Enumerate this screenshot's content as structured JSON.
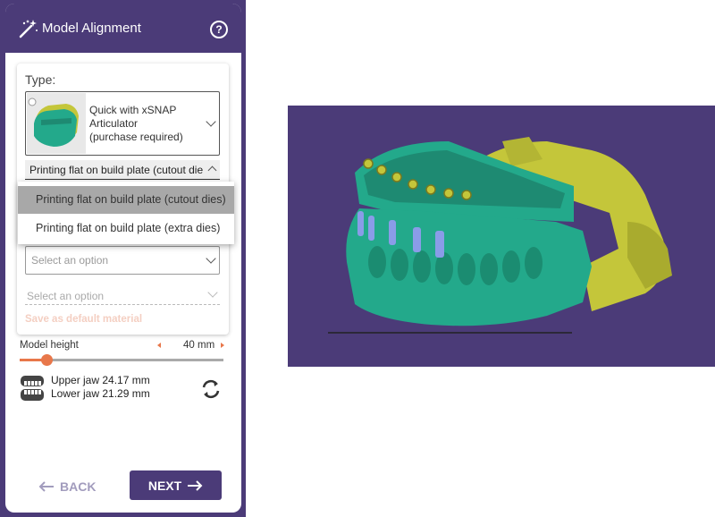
{
  "header": {
    "title": "Model Alignment",
    "help_icon": "?"
  },
  "type_section": {
    "label": "Type:",
    "selected_type": "Quick with xSNAP\nArticulator\n(purchase required)"
  },
  "method_select": {
    "value": "Printing flat on build plate (cutout dies)"
  },
  "dropdown": {
    "options": [
      "Printing flat on build plate (cutout dies)",
      "Printing flat on build plate (extra dies)"
    ],
    "selected_index": 0
  },
  "material_select": {
    "placeholder": "Select an option"
  },
  "material_select_2": {
    "placeholder": "Select an option"
  },
  "default_material_link": "Save as default material",
  "model_height": {
    "label": "Model height",
    "value": "40 mm",
    "slider_fraction": 0.13
  },
  "jaw_info": {
    "upper": "Upper jaw 24.17 mm",
    "lower": "Lower jaw 21.29 mm"
  },
  "footer": {
    "back_label": "BACK",
    "next_label": "NEXT"
  },
  "colors": {
    "brand_purple": "#4b3b78",
    "accent_orange": "#e8774a",
    "model_teal": "#23a98b",
    "articulator_yellow": "#c4c63a",
    "die_blue": "#8a9ce8"
  },
  "icons": [
    "magic-wand-icon",
    "help-icon",
    "chevron-down-icon",
    "chevron-up-icon",
    "arrow-left-icon",
    "arrow-right-icon",
    "teeth-icon",
    "sync-icon"
  ]
}
